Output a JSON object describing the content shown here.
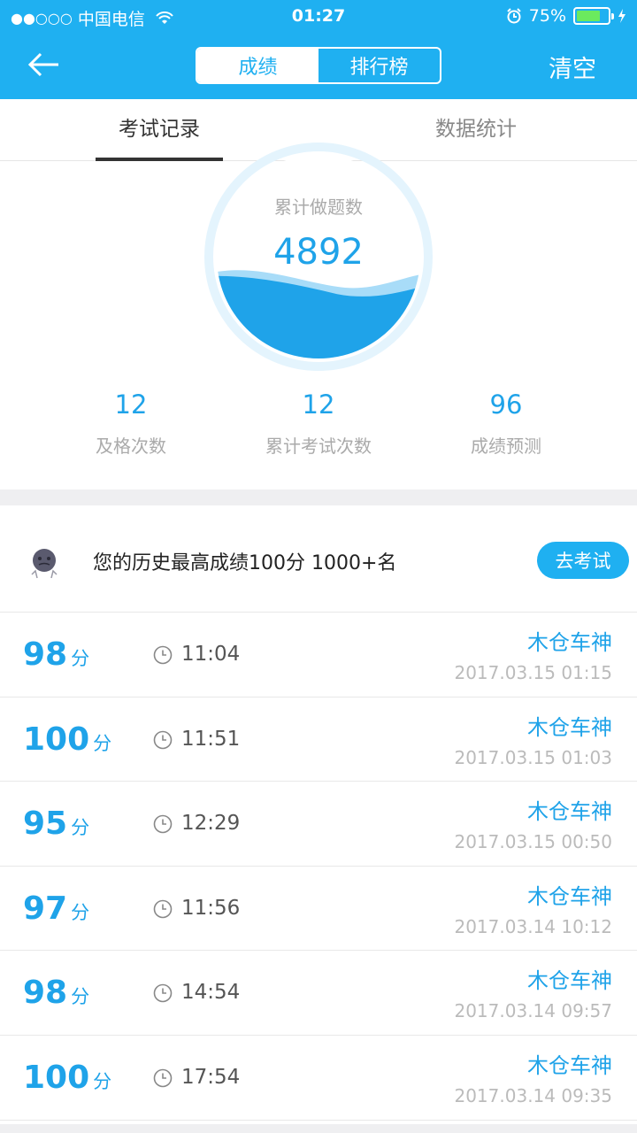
{
  "status_bar": {
    "signal": "●●○○○",
    "carrier": "中国电信",
    "time": "01:27",
    "battery_percent": "75%",
    "battery_level": 0.75
  },
  "nav": {
    "segments": [
      "成绩",
      "排行榜"
    ],
    "active_segment": 0,
    "clear_label": "清空"
  },
  "tabs": [
    "考试记录",
    "数据统计"
  ],
  "gauge": {
    "label": "累计做题数",
    "value": "4892"
  },
  "stats": [
    {
      "value": "12",
      "label": "及格次数"
    },
    {
      "value": "12",
      "label": "累计考试次数"
    },
    {
      "value": "96",
      "label": "成绩预测"
    }
  ],
  "best": {
    "text": "您的历史最高成绩100分 1000+名",
    "button": "去考试"
  },
  "records": [
    {
      "score": "98",
      "unit": "分",
      "duration": "11:04",
      "name": "木仓车神",
      "date": "2017.03.15 01:15"
    },
    {
      "score": "100",
      "unit": "分",
      "duration": "11:51",
      "name": "木仓车神",
      "date": "2017.03.15 01:03"
    },
    {
      "score": "95",
      "unit": "分",
      "duration": "12:29",
      "name": "木仓车神",
      "date": "2017.03.15 00:50"
    },
    {
      "score": "97",
      "unit": "分",
      "duration": "11:56",
      "name": "木仓车神",
      "date": "2017.03.14 10:12"
    },
    {
      "score": "98",
      "unit": "分",
      "duration": "14:54",
      "name": "木仓车神",
      "date": "2017.03.14 09:57"
    },
    {
      "score": "100",
      "unit": "分",
      "duration": "17:54",
      "name": "木仓车神",
      "date": "2017.03.14 09:35"
    }
  ],
  "colors": {
    "brand": "#1fb0f1",
    "accent_text": "#1fa3e9"
  },
  "icons": [
    "back-arrow-icon",
    "wifi-icon",
    "alarm-icon",
    "battery-icon",
    "charging-icon",
    "clock-icon",
    "avatar-icon"
  ]
}
